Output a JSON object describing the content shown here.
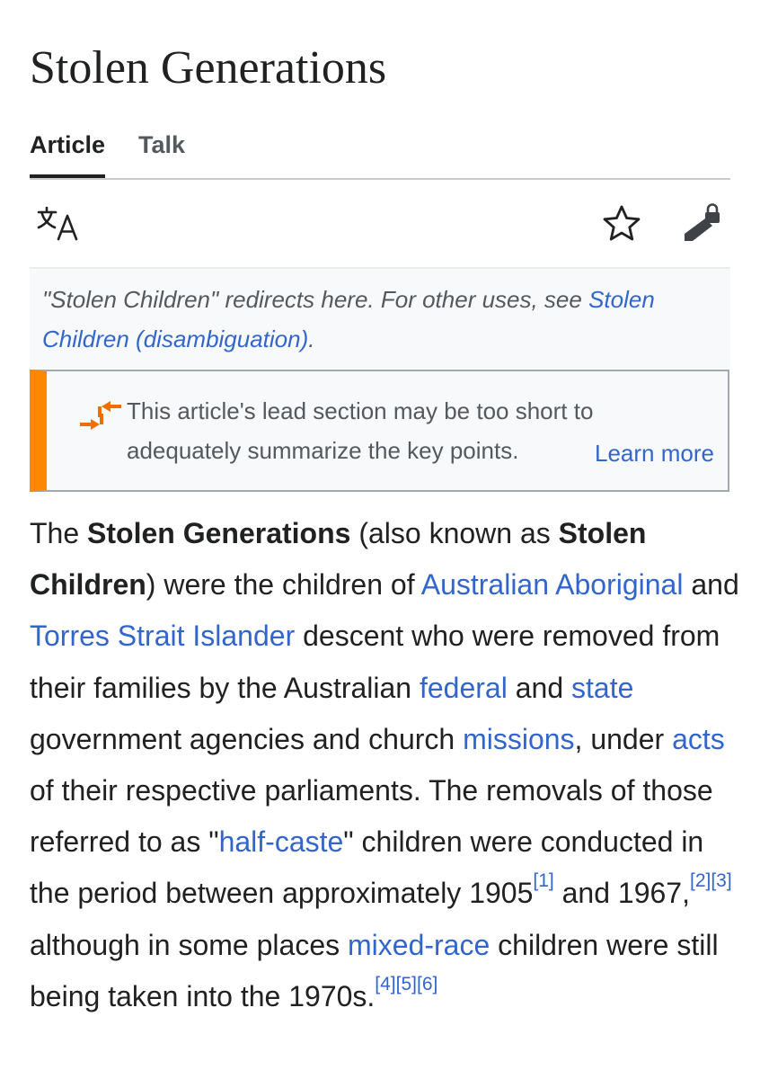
{
  "page": {
    "title": "Stolen Generations"
  },
  "tabs": {
    "article": "Article",
    "talk": "Talk"
  },
  "toolbar": {
    "language_icon": "translate-icon",
    "watch_icon": "star-icon",
    "edit_icon": "edit-lock-icon"
  },
  "hatnote": {
    "text": "\"Stolen Children\" redirects here. For other uses, see ",
    "link": "Stolen Children (disambiguation)",
    "end": "."
  },
  "notice": {
    "icon": "merge-arrows-icon",
    "text": "This article's lead section may be too short to adequately summarize the key points.",
    "learn_more": "Learn more",
    "accent_color": "#fc8700"
  },
  "lead": {
    "t1": "The ",
    "b1": "Stolen Generations",
    "t2": " (also known as ",
    "b2": "Stolen Children",
    "t3": ") were the children of ",
    "l1": "Australian Aboriginal",
    "t4": " and ",
    "l2": "Torres Strait Islander",
    "t5": " descent who were removed from their families by the Australian ",
    "l3": "federal",
    "t6": " and ",
    "l4": "state",
    "t7": " government agencies and church ",
    "l5": "missions",
    "t8": ", under ",
    "l6": "acts",
    "t9": " of their respective parliaments. The removals of those referred to as \"",
    "l7": "half-caste",
    "t10": "\" children were conducted in the period between approximately 1905",
    "r1": "[1]",
    "t11": " and 1967,",
    "r2": "[2]",
    "r3": "[3]",
    "t12": " although in some places ",
    "l8": "mixed-race",
    "t13": " children were still being taken into the 1970s.",
    "r4": "[4]",
    "r5": "[5]",
    "r6": "[6]"
  },
  "colors": {
    "link": "#3366cc",
    "text": "#202122",
    "muted": "#54595d"
  }
}
